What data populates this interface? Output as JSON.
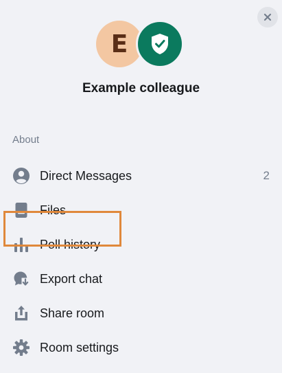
{
  "room": {
    "name": "Example colleague",
    "avatar_letter": "E",
    "avatar_color": "#f3c7a2",
    "shield_color": "#0b7a5e"
  },
  "header": {
    "close_icon": "close-icon"
  },
  "sections": {
    "about_label": "About"
  },
  "menu": {
    "items": [
      {
        "label": "Direct Messages",
        "icon": "person-icon",
        "count": "2"
      },
      {
        "label": "Files",
        "icon": "file-icon"
      },
      {
        "label": "Poll history",
        "icon": "poll-icon",
        "highlighted": true
      },
      {
        "label": "Export chat",
        "icon": "export-chat-icon"
      },
      {
        "label": "Share room",
        "icon": "share-icon"
      },
      {
        "label": "Room settings",
        "icon": "settings-icon"
      }
    ]
  },
  "colors": {
    "background": "#f1f2f6",
    "icon": "#737d8c",
    "highlight_border": "#e0883b"
  }
}
